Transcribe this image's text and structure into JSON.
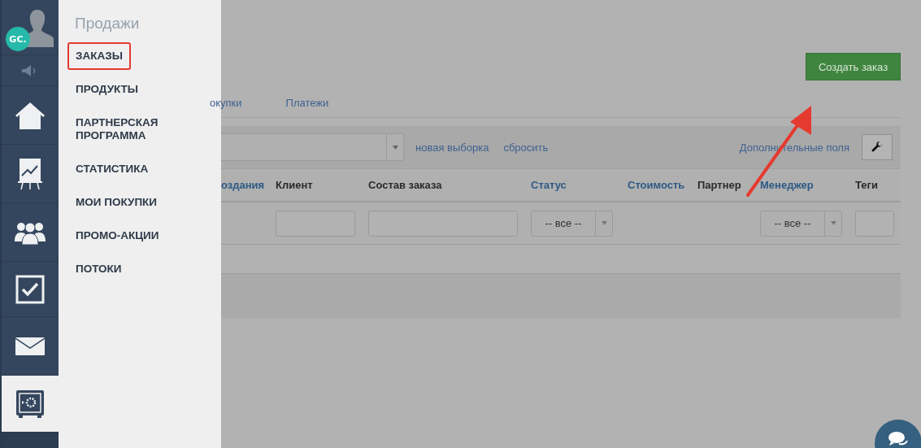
{
  "rail": {
    "avatar": {
      "initials": "GC."
    },
    "items": [
      {
        "kind": "speaker",
        "selected": false
      },
      {
        "kind": "home",
        "selected": false
      },
      {
        "kind": "chart",
        "selected": false
      },
      {
        "kind": "users",
        "selected": false
      },
      {
        "kind": "tasks",
        "selected": false
      },
      {
        "kind": "mail",
        "selected": false
      },
      {
        "kind": "safe",
        "selected": true
      }
    ]
  },
  "flyout": {
    "title": "Продажи",
    "items": [
      {
        "label": "ЗАКАЗЫ",
        "selected": true
      },
      {
        "label": "ПРОДУКТЫ",
        "selected": false
      },
      {
        "label": "ПАРТНЕРСКАЯ ПРОГРАММА",
        "selected": false
      },
      {
        "label": "СТАТИСТИКА",
        "selected": false
      },
      {
        "label": "МОИ ПОКУПКИ",
        "selected": false
      },
      {
        "label": "ПРОМО-АКЦИИ",
        "selected": false
      },
      {
        "label": "ПОТОКИ",
        "selected": false
      }
    ]
  },
  "create_button": "Создать заказ",
  "tabs": [
    {
      "label": "окупки",
      "selected": false
    },
    {
      "label": "Платежи",
      "selected": false
    }
  ],
  "filter_bar": {
    "links": [
      "новая выборка",
      "сбросить"
    ],
    "extra_fields": "Дополнительные поля"
  },
  "table": {
    "columns": [
      {
        "label": "оздания",
        "sortable": true
      },
      {
        "label": "Клиент",
        "sortable": false
      },
      {
        "label": "Состав заказа",
        "sortable": false
      },
      {
        "label": "Статус",
        "sortable": true
      },
      {
        "label": "Стоимость",
        "sortable": true
      },
      {
        "label": "Партнер",
        "sortable": false
      },
      {
        "label": "Менеджер",
        "sortable": true
      },
      {
        "label": "Теги",
        "sortable": false
      }
    ],
    "filters": [
      {
        "kind": "empty"
      },
      {
        "kind": "input"
      },
      {
        "kind": "input"
      },
      {
        "kind": "select",
        "value": "-- все --"
      },
      {
        "kind": "empty"
      },
      {
        "kind": "empty"
      },
      {
        "kind": "select",
        "value": "-- все --"
      },
      {
        "kind": "input"
      }
    ]
  }
}
